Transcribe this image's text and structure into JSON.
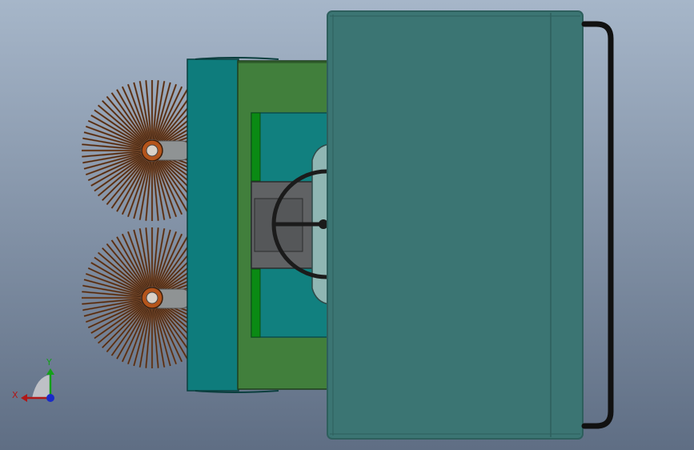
{
  "scene": {
    "background_top": "#a6b6c9",
    "background_bottom": "#5f6e84",
    "model": "street-sweeper",
    "view": "top"
  },
  "colors": {
    "front_bumper": "#0e7c7c",
    "chassis_green": "#417f3c",
    "bright_green": "#0a8a14",
    "cabin_floor": "#11807f",
    "seat": "#606264",
    "hopper": "#3b7573",
    "hopper_edge": "#2e5f5d",
    "handle": "#111111",
    "brush_bristle": "#7a4a2a",
    "brush_hub": "#b4541b",
    "steering": "#1b1b1b"
  },
  "triad": {
    "x_label": "X",
    "y_label": "Y",
    "x_color": "#b01818",
    "y_color": "#14a01a",
    "z_color": "#1a2ac8",
    "plane_color": "#c8c8cc"
  }
}
